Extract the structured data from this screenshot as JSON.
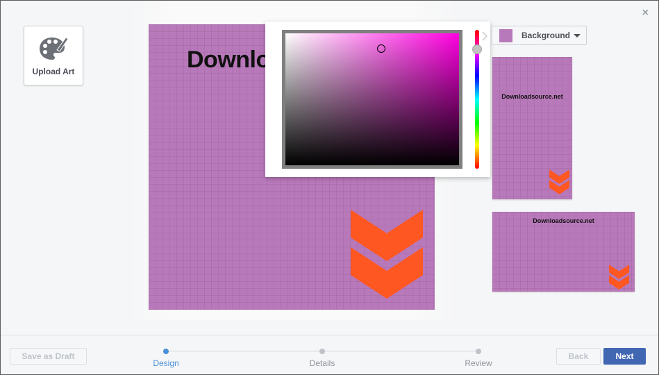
{
  "window": {
    "close_glyph": "×"
  },
  "upload": {
    "label": "Upload Art",
    "icon": "palette-icon"
  },
  "canvas": {
    "title": "Downlo",
    "background_color": "#b879ba",
    "accent_color": "#ff5722"
  },
  "color_picker": {
    "sv_hue_color": "#ff00e1",
    "selected_color": "#b879ba"
  },
  "background_dropdown": {
    "label": "Background",
    "swatch_color": "#b879ba"
  },
  "previews": {
    "vertical_title": "Downloadsource.net",
    "horizontal_title": "Downloadsource.net"
  },
  "footer": {
    "save_draft": "Save as Draft",
    "back": "Back",
    "next": "Next",
    "steps": [
      {
        "label": "Design",
        "active": true
      },
      {
        "label": "Details",
        "active": false
      },
      {
        "label": "Review",
        "active": false
      }
    ]
  },
  "colors": {
    "primary": "#4267b2",
    "active_step": "#4a90d9",
    "inactive_step": "#bec3c9"
  }
}
